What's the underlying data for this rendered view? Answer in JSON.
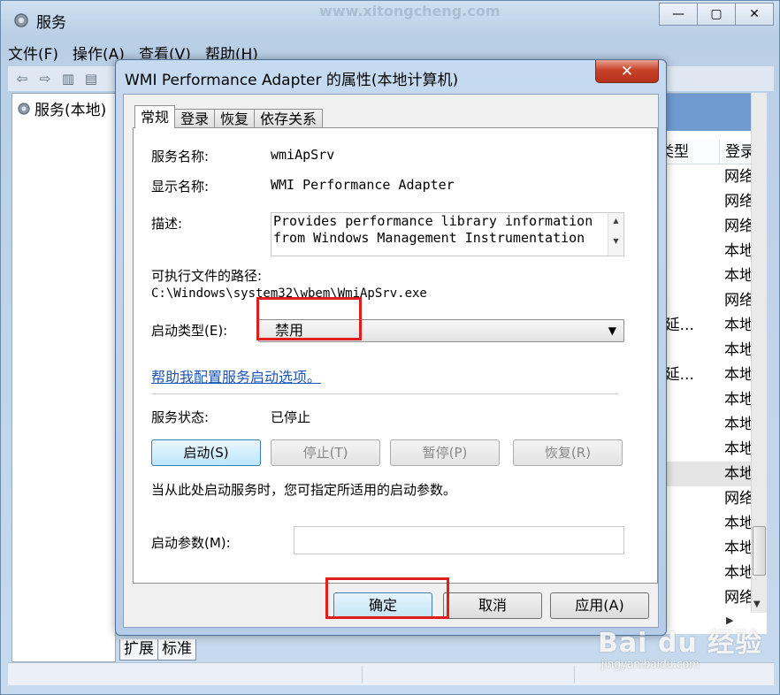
{
  "services_window": {
    "title": "服务",
    "watermark_url": "www.xitongcheng.com",
    "menu": [
      "文件(F)",
      "操作(A)",
      "查看(V)",
      "帮助(H)"
    ],
    "tree_item": "服务(本地)",
    "columns": {
      "type": "类型",
      "login": "登录"
    },
    "rows": [
      {
        "c1": "",
        "c2": "网络"
      },
      {
        "c1": "",
        "c2": "网络"
      },
      {
        "c1": "",
        "c2": "网络"
      },
      {
        "c1": "",
        "c2": "本地"
      },
      {
        "c1": "",
        "c2": "本地"
      },
      {
        "c1": "",
        "c2": "网络"
      },
      {
        "c1": "(延...",
        "c2": "本地"
      },
      {
        "c1": "",
        "c2": "本地"
      },
      {
        "c1": "(延...",
        "c2": "本地"
      },
      {
        "c1": "",
        "c2": "本地"
      },
      {
        "c1": "",
        "c2": "本地"
      },
      {
        "c1": "",
        "c2": "本地"
      },
      {
        "c1": "",
        "c2": "本地"
      },
      {
        "c1": "",
        "c2": "网络"
      },
      {
        "c1": "",
        "c2": "本地"
      },
      {
        "c1": "",
        "c2": "本地"
      },
      {
        "c1": "",
        "c2": "本地"
      },
      {
        "c1": "",
        "c2": "网络"
      }
    ],
    "bottom_tabs": [
      "扩展",
      "标准"
    ]
  },
  "dialog": {
    "title": "WMI Performance Adapter 的属性(本地计算机)",
    "close_glyph": "✕",
    "tabs": [
      "常规",
      "登录",
      "恢复",
      "依存关系"
    ],
    "service_name_label": "服务名称:",
    "service_name": "wmiApSrv",
    "display_name_label": "显示名称:",
    "display_name": "WMI Performance Adapter",
    "description_label": "描述:",
    "description": "Provides performance library information from Windows Management Instrumentation",
    "path_label": "可执行文件的路径:",
    "path": "C:\\Windows\\system32\\wbem\\WmiApSrv.exe",
    "startup_type_label": "启动类型(E):",
    "startup_type": "禁用",
    "help_link": "帮助我配置服务启动选项。",
    "status_label": "服务状态:",
    "status": "已停止",
    "buttons": {
      "start": "启动(S)",
      "stop": "停止(T)",
      "pause": "暂停(P)",
      "resume": "恢复(R)"
    },
    "hint": "当从此处启动服务时，您可指定所适用的启动参数。",
    "params_label": "启动参数(M):",
    "params_value": "",
    "ok": "确定",
    "cancel": "取消",
    "apply": "应用(A)"
  },
  "watermark": {
    "logo": "Bai du 经验",
    "sub": "jingyan.baidu.com"
  },
  "colors": {
    "highlight": "#e01e1e",
    "link": "#1e56b6"
  }
}
